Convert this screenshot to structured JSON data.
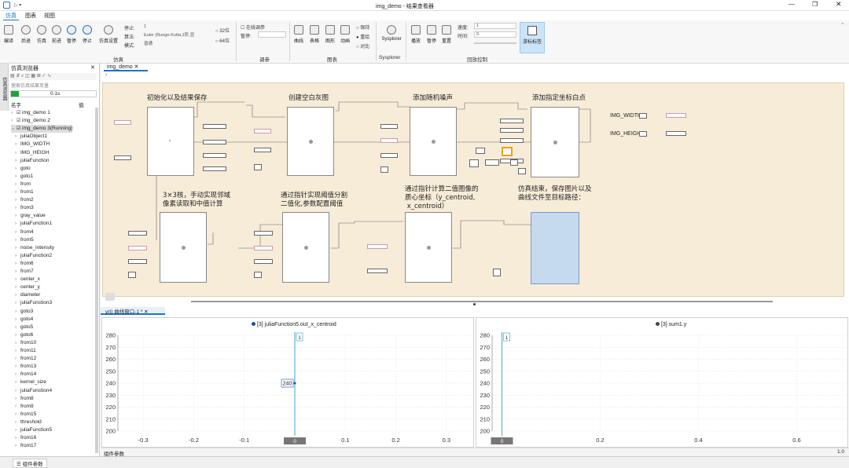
{
  "window": {
    "title": "img_demo - 结果查看器"
  },
  "menu": {
    "items": [
      "仿真",
      "图表",
      "视图"
    ]
  },
  "ribbon": {
    "sim_buttons": [
      "编译",
      "后退",
      "仿真",
      "前进",
      "暂停",
      "停止",
      "仿真设置"
    ],
    "sim_group": "仿真",
    "stop_label": "停止:",
    "stop_value": "1",
    "algo_label": "算法:",
    "algo_value": "Euler (Runge-Kutta,1阶,显",
    "mode_label": "模式:",
    "mode_value": "普通",
    "bit32": "32位",
    "bit64": "64位",
    "online_label": "在线调参",
    "pause_label": "暂停:",
    "param_group": "调参",
    "chart_buttons": [
      "曲线",
      "表格",
      "图形",
      "动画"
    ],
    "chart_group": "图表",
    "keep": "保持",
    "overlay": "重绘",
    "compare": "对比",
    "sysplorer_btn": "Sysplorer",
    "sysplorer_group": "Sysplorer",
    "play_buttons": [
      "播放",
      "暂停",
      "重置"
    ],
    "speed_label": "速度:",
    "speed_value": "1",
    "time_label": "时间:",
    "time_value": "0",
    "cursor_btn": "游标标签",
    "play_group": "回放控制"
  },
  "left": {
    "title": "仿真浏览器",
    "search_placeholder": "搜索仿真结果变量",
    "time_value": "0.1s",
    "col_name": "名字",
    "col_value": "值",
    "side_tab": "仿真浏览器",
    "items": [
      "img_demo 1",
      "img_demo 2",
      "img_demo 3(Running)",
      "juliaObject1",
      "IMG_WIDTH",
      "IMG_HEIGH",
      "juliaFunction",
      "goto",
      "goto1",
      "from",
      "from1",
      "from2",
      "from3",
      "gray_value",
      "juliaFunction1",
      "from4",
      "from5",
      "noise_intensity",
      "juliaFunction2",
      "from6",
      "from7",
      "center_x",
      "center_y",
      "diameter",
      "juliaFunction3",
      "goto3",
      "goto4",
      "goto5",
      "goto6",
      "from10",
      "from11",
      "from12",
      "from13",
      "from14",
      "kernel_size",
      "juliaFunction4",
      "from8",
      "from9",
      "from15",
      "threshold",
      "juliaFunction5",
      "from16",
      "from17"
    ]
  },
  "tab": {
    "label": "img_demo"
  },
  "diagram": {
    "titles": [
      "初始化以及结果保存",
      "创建空白灰图",
      "添加随机噪声",
      "添加指定坐标白点",
      "3×3核，手动实现邻域\n像素读取和中值计算",
      "通过指针实现阈值分割\n二值化,参数配置阈值",
      "通过指针计算二值图像的\n质心坐标（y_centroid,\n x_centroid）",
      "仿真结束，保存图片以及\n曲线文件至目标路径："
    ],
    "img_width": "IMG_WIDTH",
    "img_heigh": "IMG_HEIGH"
  },
  "plots_tab": {
    "label": "y(t) 曲线窗口-1 *"
  },
  "colors": {
    "left_legend": "#1f4fa8",
    "right_legend": "#444444",
    "cursor": "#5bb7d6",
    "diagram_bg": "#f7ecd8"
  },
  "chart_data": [
    {
      "type": "line",
      "title": "[3] juliaFunction5.out_x_centroid",
      "legend_color": "#1f4fa8",
      "ylim": [
        200,
        280
      ],
      "yticks": [
        280,
        270,
        260,
        250,
        240,
        230,
        220,
        210,
        200
      ],
      "xlim": [
        -0.35,
        0.35
      ],
      "xticks": [
        -0.3,
        -0.2,
        -0.1,
        0,
        0.1,
        0.2,
        0.3
      ],
      "cursor_x": 0,
      "cursor_label": "1",
      "point_label": "240",
      "series": [
        {
          "name": "[3] juliaFunction5.out_x_centroid",
          "x": [
            0
          ],
          "y": [
            240
          ]
        }
      ]
    },
    {
      "type": "line",
      "title": "[3] sum1.y",
      "legend_color": "#444444",
      "ylim": [
        200,
        280
      ],
      "yticks": [
        280,
        270,
        260,
        250,
        240,
        230,
        220,
        210,
        200
      ],
      "xlim": [
        -0.02,
        0.7
      ],
      "xticks": [
        0,
        0.2,
        0.4,
        0.6
      ],
      "cursor_x": 0,
      "cursor_label": "1",
      "series": [
        {
          "name": "[3] sum1.y",
          "x": [],
          "y": []
        }
      ]
    }
  ],
  "status": {
    "component_params": "组件参数",
    "props_tab": "组件参数",
    "zoom": "1.0"
  }
}
